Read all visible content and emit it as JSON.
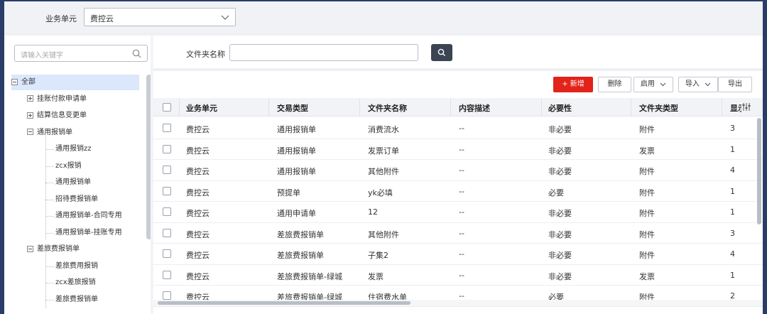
{
  "header": {
    "bu_label": "业务单元",
    "bu_value": "费控云"
  },
  "sidebar": {
    "search_placeholder": "请输入关键字",
    "tree": [
      {
        "label": "全部",
        "level": 0,
        "toggle": "minus",
        "selected": true
      },
      {
        "label": "挂账付款申请单",
        "level": 1,
        "toggle": "plus"
      },
      {
        "label": "结算信息变更单",
        "level": 1,
        "toggle": "plus"
      },
      {
        "label": "通用报销单",
        "level": 1,
        "toggle": "minus"
      },
      {
        "label": "通用报销zz",
        "level": 2
      },
      {
        "label": "zcx报销",
        "level": 2
      },
      {
        "label": "通用报销单",
        "level": 2
      },
      {
        "label": "招待费报销单",
        "level": 2
      },
      {
        "label": "通用报销单-合同专用",
        "level": 2
      },
      {
        "label": "通用报销单-挂账专用",
        "level": 2
      },
      {
        "label": "差旅费报销单",
        "level": 1,
        "toggle": "minus"
      },
      {
        "label": "差旅费用报销",
        "level": 2
      },
      {
        "label": "zcx差旅报销",
        "level": 2
      },
      {
        "label": "差旅费报销单",
        "level": 2
      }
    ]
  },
  "filter": {
    "folder_name_label": "文件夹名称",
    "folder_name_value": ""
  },
  "toolbar": {
    "add_label": "+ 新增",
    "delete_label": "删除",
    "enable_label": "启用",
    "import_label": "导入",
    "export_label": "导出"
  },
  "table": {
    "columns": [
      "业务单元",
      "交易类型",
      "文件夹名称",
      "内容描述",
      "必要性",
      "文件夹类型",
      "显示"
    ],
    "rows": [
      [
        "费控云",
        "通用报销单",
        "消费流水",
        "--",
        "非必要",
        "附件",
        "3"
      ],
      [
        "费控云",
        "通用报销单",
        "发票订单",
        "--",
        "非必要",
        "发票",
        "1"
      ],
      [
        "费控云",
        "通用报销单",
        "其他附件",
        "--",
        "非必要",
        "附件",
        "4"
      ],
      [
        "费控云",
        "预提单",
        "yk必填",
        "--",
        "必要",
        "附件",
        "1"
      ],
      [
        "费控云",
        "通用申请单",
        "12",
        "--",
        "非必要",
        "附件",
        "1"
      ],
      [
        "费控云",
        "差旅费报销单",
        "其他附件",
        "--",
        "非必要",
        "附件",
        "3"
      ],
      [
        "费控云",
        "差旅费报销单",
        "子集2",
        "--",
        "非必要",
        "附件",
        "4"
      ],
      [
        "费控云",
        "差旅费报销单-绿城",
        "发票",
        "--",
        "非必要",
        "发票",
        "1"
      ],
      [
        "费控云",
        "差旅费报销单-绿城",
        "住宿费水单",
        "--",
        "必要",
        "附件",
        "2"
      ]
    ]
  },
  "colors": {
    "primary": "#e2231a",
    "frame": "#2a3d68",
    "search_button": "#3a4452"
  }
}
